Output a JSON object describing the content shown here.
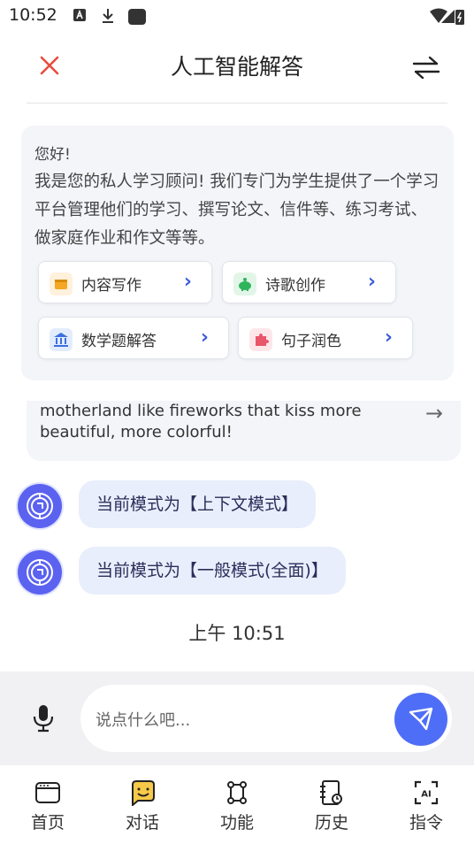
{
  "status_bar": {
    "time": "10:52"
  },
  "header": {
    "title": "人工智能解答",
    "close_icon": "close-icon",
    "swap_icon": "swap-icon"
  },
  "welcome": {
    "greeting": "您好!",
    "body": "我是您的私人学习顾问! 我们专门为学生提供了一个学习平台管理他们的学习、撰写论文、信件等、练习考试、做家庭作业和作文等等。",
    "chips": [
      {
        "label": "内容写作",
        "icon": "wallet-icon",
        "color": "#f5a623",
        "bg": "#fff1dc"
      },
      {
        "label": "诗歌创作",
        "icon": "piggy-bank-icon",
        "color": "#2fb45c",
        "bg": "#e2f6e8"
      },
      {
        "label": "数学题解答",
        "icon": "bank-icon",
        "color": "#3b6fe0",
        "bg": "#e3ecfc"
      },
      {
        "label": "句子润色",
        "icon": "puzzle-icon",
        "color": "#e9556b",
        "bg": "#fde6ea"
      }
    ]
  },
  "previous_message": {
    "text": "motherland like fireworks that kiss more beautiful, more colorful!"
  },
  "messages": [
    {
      "text": "当前模式为【上下文模式】"
    },
    {
      "text": "当前模式为【一般模式(全面)】"
    }
  ],
  "timestamp": "上午 10:51",
  "input": {
    "placeholder": "说点什么吧..."
  },
  "tabbar": [
    {
      "label": "首页",
      "icon": "browser-window-icon"
    },
    {
      "label": "对话",
      "icon": "chat-smile-icon"
    },
    {
      "label": "功能",
      "icon": "nodes-icon"
    },
    {
      "label": "历史",
      "icon": "history-book-icon"
    },
    {
      "label": "指令",
      "icon": "ai-scan-icon"
    }
  ],
  "colors": {
    "accent": "#4f6ef7",
    "close": "#e84c3d",
    "card_bg": "#f3f5f9",
    "bubble_bg": "#e9eefc"
  }
}
